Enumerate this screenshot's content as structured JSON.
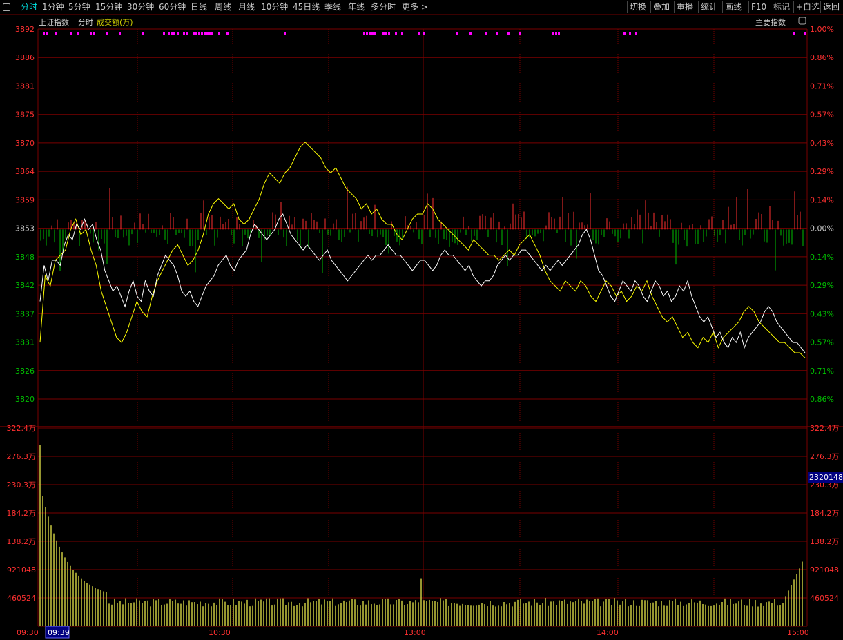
{
  "toolbar": {
    "left": [
      {
        "label": "分时",
        "active": true
      },
      {
        "label": "1分钟"
      },
      {
        "label": "5分钟"
      },
      {
        "label": "15分钟"
      },
      {
        "label": "30分钟"
      },
      {
        "label": "60分钟"
      },
      {
        "label": "日线"
      },
      {
        "label": "周线"
      },
      {
        "label": "月线"
      },
      {
        "label": "10分钟"
      },
      {
        "label": "45日线"
      },
      {
        "label": "季线"
      },
      {
        "label": "年线"
      },
      {
        "label": "多分时"
      },
      {
        "label": "更多 >"
      }
    ],
    "right": [
      {
        "label": "切换"
      },
      {
        "label": "叠加"
      },
      {
        "label": "重播"
      },
      {
        "label": "统计"
      },
      {
        "label": "画线"
      },
      {
        "label": "F10"
      },
      {
        "label": "标记"
      },
      {
        "label": "+自选"
      },
      {
        "label": "返回"
      }
    ]
  },
  "header": {
    "index_name": "上证指数",
    "mode": "分时",
    "volume_label": "成交额(万)",
    "main_index_button": "主要指数"
  },
  "colors": {
    "background": "#000000",
    "grid": "#7a0000",
    "up": "#ff3030",
    "down": "#00c000",
    "price_line": "#ffffff",
    "avg_line": "#ffff00",
    "volume": "#c8c840",
    "marker": "#ff00ff",
    "cursor_box": "#000080"
  },
  "chart_data": {
    "type": "line",
    "price_axis": {
      "ylim": [
        3820,
        3892
      ],
      "ticks": [
        "3892",
        "3886",
        "3881",
        "3875",
        "3870",
        "3864",
        "3859",
        "3853",
        "3848",
        "3842",
        "3837",
        "3831",
        "3826",
        "3820"
      ]
    },
    "pct_axis": {
      "ticks": [
        "1.00%",
        "0.86%",
        "0.71%",
        "0.57%",
        "0.43%",
        "0.29%",
        "0.14%",
        "0.00%",
        "0.14%",
        "0.29%",
        "0.43%",
        "0.57%",
        "0.71%",
        "0.86%"
      ]
    },
    "volume_axis": {
      "ylim": [
        0,
        3224000
      ],
      "ticks": [
        "322.4万",
        "276.3万",
        "230.3万",
        "184.2万",
        "138.2万",
        "921048",
        "460524"
      ]
    },
    "time_axis": {
      "labels": [
        "09:30",
        "10:30",
        "13:00",
        "14:00",
        "15:00"
      ],
      "cursor_time": "09:39"
    },
    "current_volume_readout": "2320148",
    "series": [
      {
        "role": "price",
        "values": [
          3839,
          3846,
          3843,
          3847,
          3847,
          3846,
          3850,
          3852,
          3851,
          3854,
          3853,
          3855,
          3853,
          3854,
          3851,
          3849,
          3845,
          3843,
          3841,
          3842,
          3840,
          3838,
          3841,
          3843,
          3840,
          3839,
          3843,
          3841,
          3840,
          3844,
          3846,
          3848,
          3847,
          3846,
          3844,
          3841,
          3840,
          3841,
          3839,
          3838,
          3840,
          3842,
          3843,
          3844,
          3846,
          3847,
          3848,
          3846,
          3845,
          3847,
          3848,
          3849,
          3852,
          3854,
          3853,
          3852,
          3851,
          3852,
          3853,
          3855,
          3856,
          3854,
          3852,
          3851,
          3850,
          3849,
          3850,
          3849,
          3848,
          3847,
          3848,
          3849,
          3847,
          3846,
          3845,
          3844,
          3843,
          3844,
          3845,
          3846,
          3847,
          3848,
          3847,
          3848,
          3848,
          3849,
          3850,
          3849,
          3848,
          3848,
          3847,
          3846,
          3845,
          3846,
          3847,
          3847,
          3846,
          3845,
          3846,
          3848,
          3849,
          3848,
          3848,
          3847,
          3846,
          3845,
          3846,
          3844,
          3843,
          3842,
          3843,
          3843,
          3844,
          3846,
          3847,
          3848,
          3847,
          3848,
          3848,
          3849,
          3849,
          3848,
          3847,
          3846,
          3845,
          3846,
          3845,
          3846,
          3847,
          3846,
          3847,
          3848,
          3849,
          3850,
          3852,
          3853,
          3851,
          3848,
          3845,
          3844,
          3842,
          3840,
          3839,
          3841,
          3843,
          3842,
          3841,
          3843,
          3842,
          3840,
          3839,
          3841,
          3843,
          3842,
          3840,
          3841,
          3839,
          3840,
          3842,
          3841,
          3843,
          3840,
          3838,
          3836,
          3835,
          3836,
          3834,
          3832,
          3833,
          3831,
          3830,
          3832,
          3831,
          3833,
          3830,
          3832,
          3833,
          3834,
          3835,
          3837,
          3838,
          3837,
          3835,
          3834,
          3833,
          3832,
          3831,
          3831,
          3830,
          3829
        ]
      },
      {
        "role": "average",
        "values": [
          3831,
          3844,
          3842,
          3847,
          3848,
          3849,
          3853,
          3855,
          3852,
          3853,
          3849,
          3846,
          3841,
          3838,
          3835,
          3832,
          3831,
          3833,
          3836,
          3839,
          3837,
          3836,
          3840,
          3843,
          3845,
          3847,
          3849,
          3850,
          3848,
          3846,
          3847,
          3849,
          3852,
          3856,
          3858,
          3859,
          3858,
          3857,
          3858,
          3855,
          3854,
          3855,
          3857,
          3859,
          3862,
          3864,
          3863,
          3862,
          3864,
          3865,
          3867,
          3869,
          3870,
          3869,
          3868,
          3867,
          3865,
          3864,
          3865,
          3863,
          3861,
          3860,
          3859,
          3857,
          3858,
          3856,
          3857,
          3855,
          3854,
          3854,
          3852,
          3851,
          3853,
          3855,
          3856,
          3856,
          3858,
          3857,
          3855,
          3854,
          3853,
          3852,
          3851,
          3850,
          3849,
          3851,
          3850,
          3849,
          3848,
          3848,
          3847,
          3848,
          3849,
          3848,
          3850,
          3851,
          3852,
          3850,
          3848,
          3845,
          3843,
          3842,
          3841,
          3843,
          3842,
          3841,
          3843,
          3842,
          3840,
          3839,
          3841,
          3843,
          3842,
          3840,
          3841,
          3839,
          3840,
          3842,
          3841,
          3843,
          3840,
          3838,
          3836,
          3835,
          3836,
          3834,
          3832,
          3833,
          3831,
          3830,
          3832,
          3831,
          3833,
          3830,
          3832,
          3833,
          3834,
          3835,
          3837,
          3838,
          3837,
          3835,
          3834,
          3833,
          3832,
          3831,
          3831,
          3830,
          3829,
          3829,
          3828
        ]
      }
    ]
  }
}
